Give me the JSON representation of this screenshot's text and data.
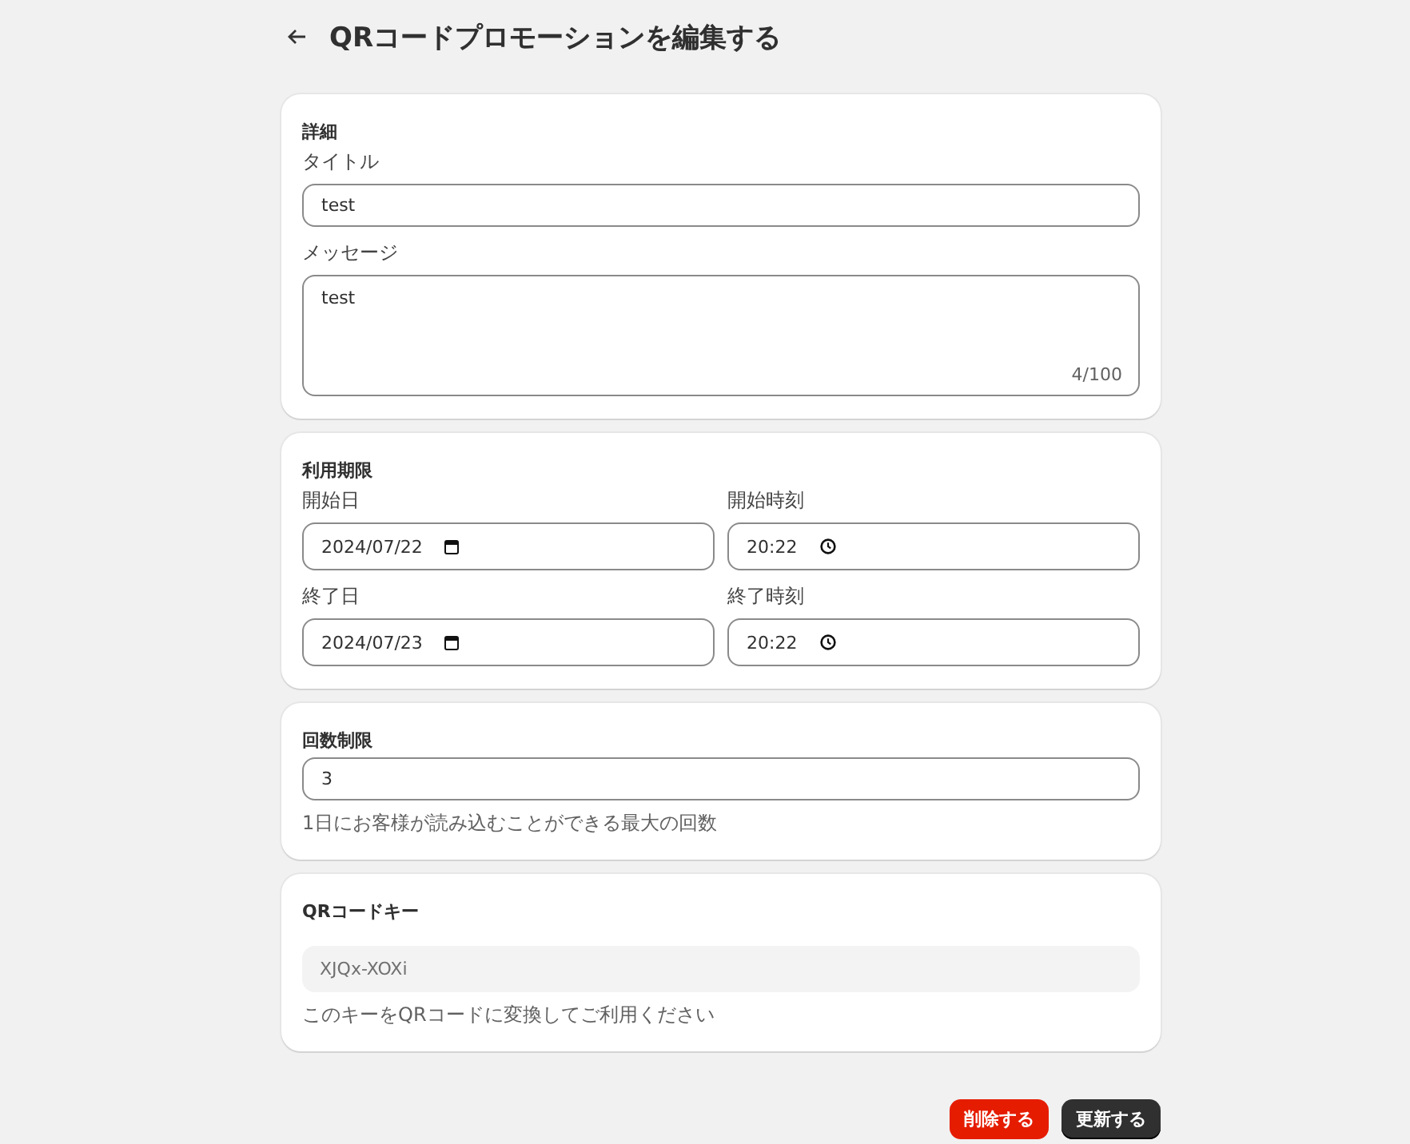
{
  "header": {
    "title": "QRコードプロモーションを編集する"
  },
  "sections": [
    {
      "kind": "stack",
      "heading": "詳細",
      "fields": [
        {
          "kind": "text",
          "label": "タイトル",
          "value": "test"
        },
        {
          "kind": "textarea",
          "label": "メッセージ",
          "value": "test",
          "counter": "4/100"
        }
      ]
    },
    {
      "kind": "grid",
      "heading": "利用期限",
      "fields": [
        {
          "kind": "date",
          "label": "開始日",
          "value": "2024/07/22"
        },
        {
          "kind": "time",
          "label": "開始時刻",
          "value": "20:22"
        },
        {
          "kind": "date",
          "label": "終了日",
          "value": "2024/07/23"
        },
        {
          "kind": "time",
          "label": "終了時刻",
          "value": "20:22"
        }
      ]
    },
    {
      "kind": "stack",
      "heading": "回数制限",
      "fields": [
        {
          "kind": "text",
          "value": "3"
        }
      ],
      "hint": "1日にお客様が読み込むことができる最大の回数"
    },
    {
      "kind": "spaced",
      "heading": "QRコードキー",
      "fields": [
        {
          "kind": "readonly",
          "value": "XJQx-XOXi"
        }
      ],
      "hint": "このキーをQRコードに変換してご利用ください"
    }
  ],
  "buttons": [
    {
      "kind": "danger",
      "label": "削除する"
    },
    {
      "kind": "primary",
      "label": "更新する"
    }
  ]
}
